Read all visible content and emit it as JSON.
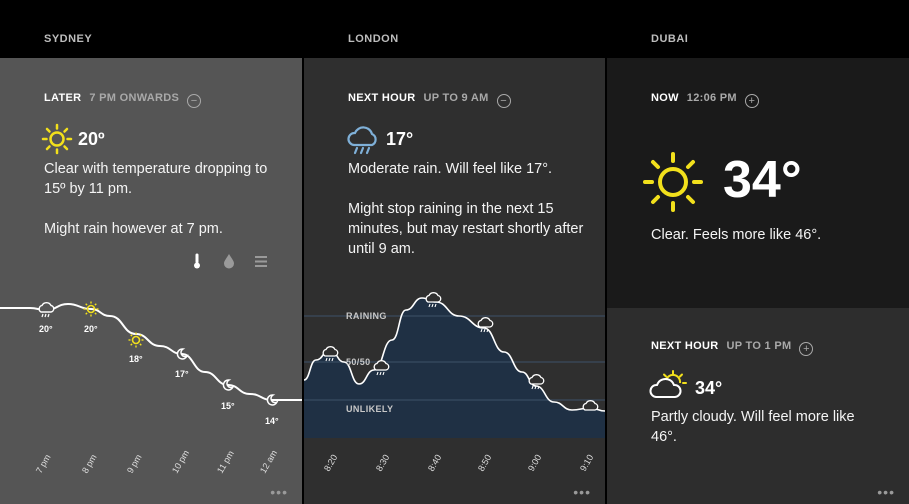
{
  "sydney": {
    "city": "SYDNEY",
    "period_label": "LATER",
    "period_sub": "7 PM ONWARDS",
    "toggle": "−",
    "temp": "20º",
    "desc": "Clear with temperature dropping to 15º by 11 pm.",
    "note": "Might rain however at 7 pm.",
    "icons": [
      "thermometer-icon",
      "drop-icon",
      "bars-icon"
    ],
    "points": [
      {
        "label": "20°",
        "icon": "rain"
      },
      {
        "label": "20°",
        "icon": "sun"
      },
      {
        "label": "18°",
        "icon": "sun"
      },
      {
        "label": "17°",
        "icon": "moon"
      },
      {
        "label": "15°",
        "icon": "moon"
      },
      {
        "label": "14°",
        "icon": "moon"
      }
    ],
    "times": [
      "7 pm",
      "8 pm",
      "9 pm",
      "10 pm",
      "11 pm",
      "12 am"
    ],
    "more": "•••"
  },
  "london": {
    "city": "LONDON",
    "period_label": "NEXT HOUR",
    "period_sub": "UP TO 9 AM",
    "toggle": "−",
    "temp": "17°",
    "desc": "Moderate rain. Will feel like 17°.",
    "note": "Might stop raining in the next 15 minutes, but may restart shortly after until 9 am.",
    "zones": [
      "RAINING",
      "50/50",
      "UNLIKELY"
    ],
    "times": [
      "8:20",
      "8:30",
      "8:40",
      "8:50",
      "9:00",
      "9:10"
    ],
    "more": "•••"
  },
  "dubai": {
    "city": "DUBAI",
    "now_label": "NOW",
    "now_time": "12:06 PM",
    "toggle": "+",
    "temp": "34°",
    "desc": "Clear. Feels more like 46°.",
    "next_label": "NEXT HOUR",
    "next_sub": "UP TO 1 PM",
    "next_toggle": "+",
    "next_temp": "34°",
    "next_desc": "Partly cloudy. Will feel more like 46°.",
    "more": "•••"
  },
  "colors": {
    "sun": "#f2e01c",
    "rain_fill": "#1f3044",
    "line": "#ffffff"
  }
}
